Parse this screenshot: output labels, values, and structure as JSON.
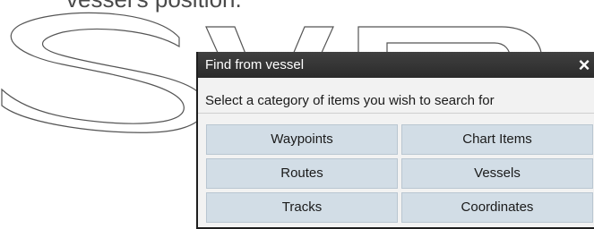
{
  "background": {
    "caption": "vessel's position.",
    "watermark": "SVB"
  },
  "dialog": {
    "title": "Find from vessel",
    "close_label": "×",
    "prompt": "Select a category of items you wish to search for",
    "categories": {
      "waypoints": "Waypoints",
      "chart_items": "Chart Items",
      "routes": "Routes",
      "vessels": "Vessels",
      "tracks": "Tracks",
      "coordinates": "Coordinates"
    }
  },
  "colors": {
    "titlebar": "#333333",
    "button": "#d2dde6",
    "dialog_bg": "#f2f2f2"
  }
}
